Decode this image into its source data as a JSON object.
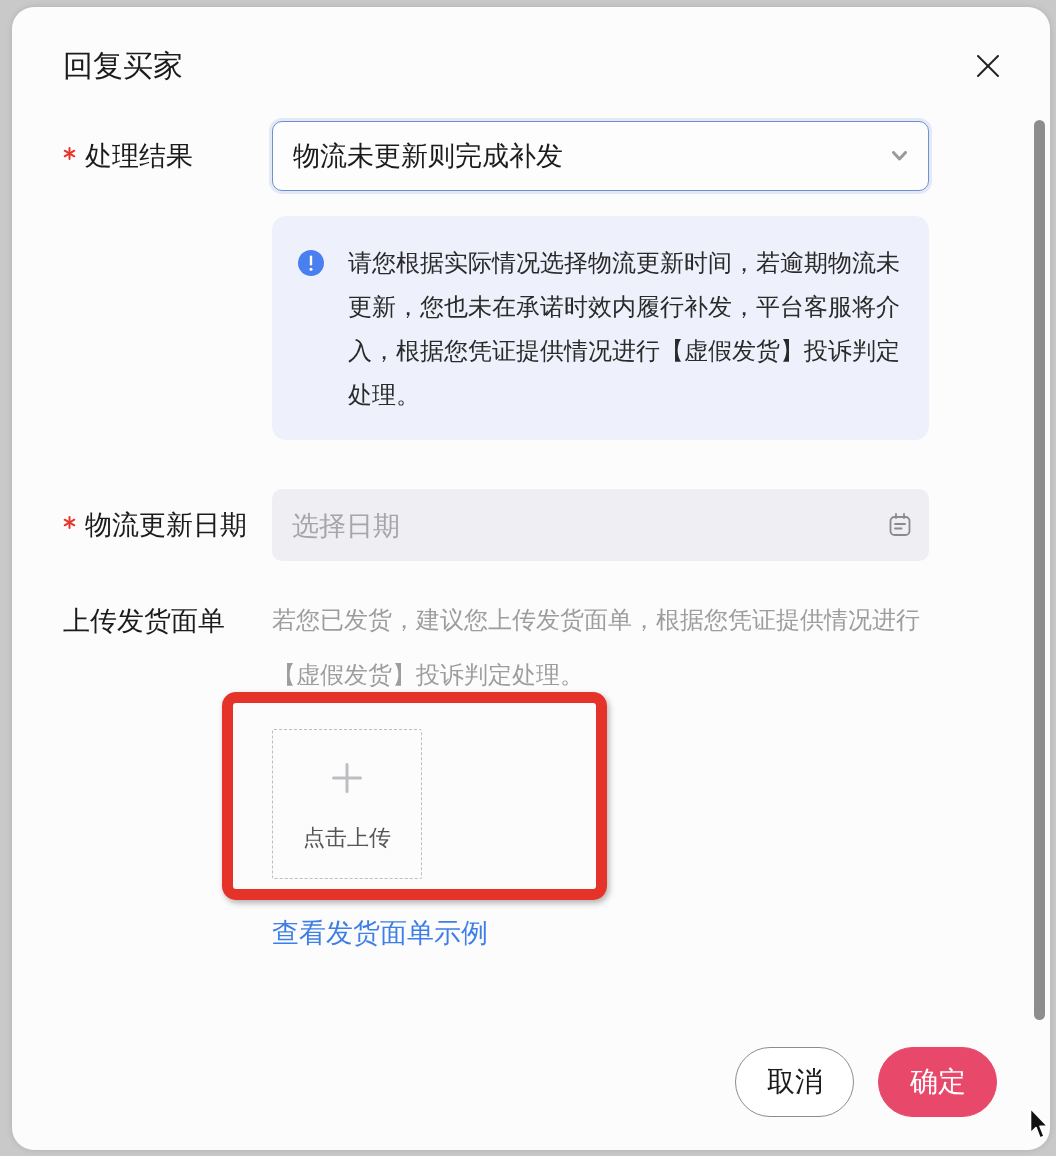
{
  "dialog": {
    "title": "回复买家"
  },
  "fields": [
    {
      "kind": "select",
      "label": "处理结果",
      "required": true,
      "value": "物流未更新则完成补发",
      "focused": true
    },
    {
      "kind": "notice",
      "text": "请您根据实际情况选择物流更新时间，若逾期物流未更新，您也未在承诺时效内履行补发，平台客服将介入，根据您凭证提供情况进行【虚假发货】投诉判定处理。"
    },
    {
      "kind": "date",
      "label": "物流更新日期",
      "required": true,
      "placeholder": "选择日期"
    },
    {
      "kind": "upload",
      "label": "上传发货面单",
      "required": false,
      "hint": "若您已发货，建议您上传发货面单，根据您凭证提供情况进行【虚假发货】投诉判定处理。",
      "button": "点击上传",
      "highlighted": true,
      "link": "查看发货面单示例"
    }
  ],
  "buttons": [
    {
      "label": "取消",
      "kind": "secondary"
    },
    {
      "label": "确定",
      "kind": "primary"
    }
  ]
}
